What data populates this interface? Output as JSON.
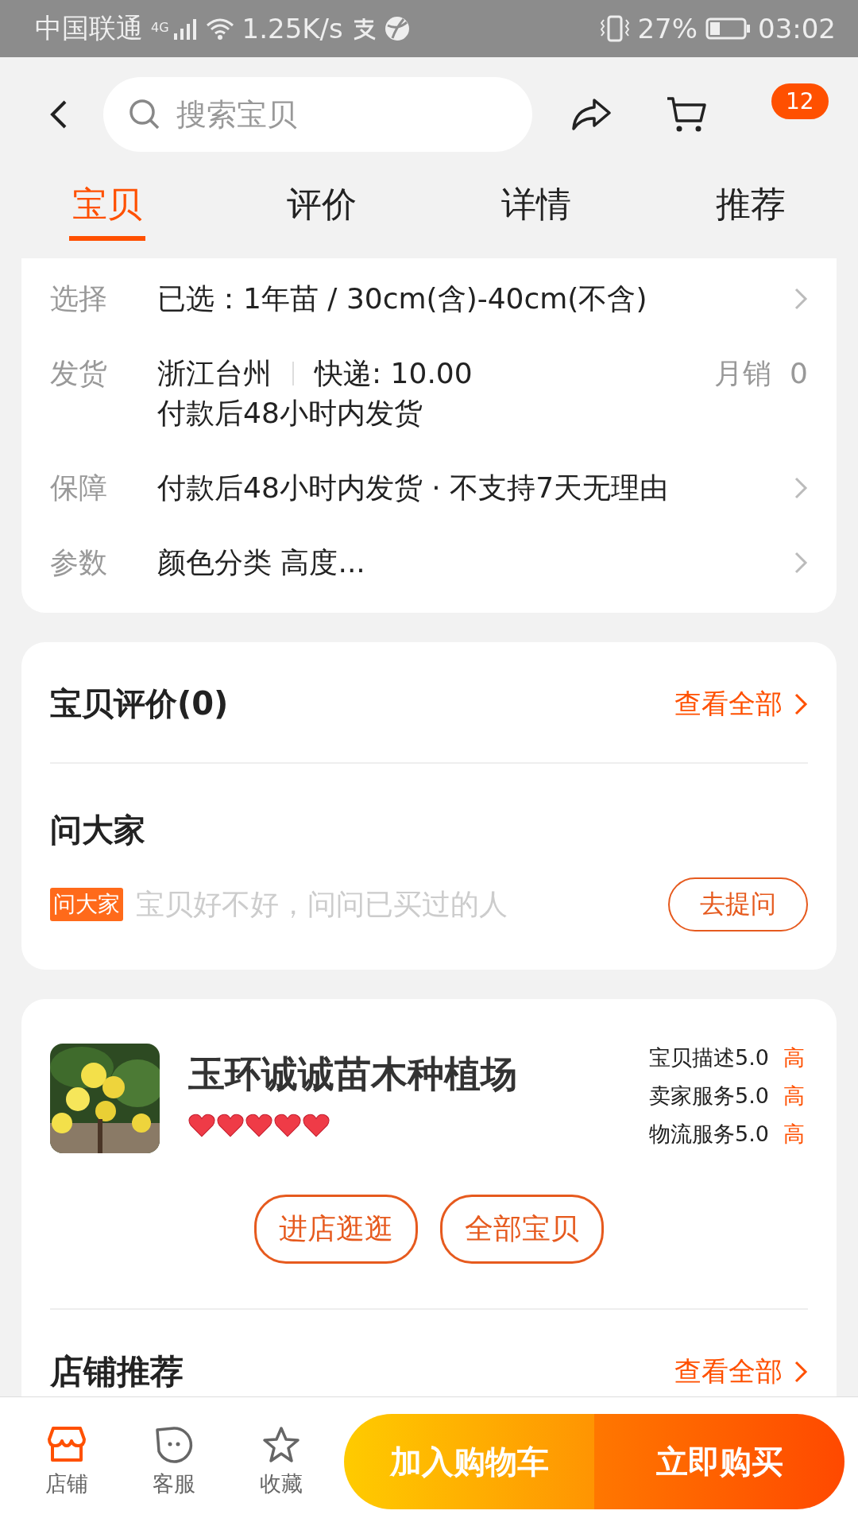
{
  "status_bar": {
    "carrier": "中国联通",
    "network": "4G",
    "speed": "1.25K/s",
    "battery": "27%",
    "time": "03:02"
  },
  "header": {
    "search": {
      "placeholder": "搜索宝贝"
    },
    "badge": "12"
  },
  "tabs": [
    {
      "label": "宝贝",
      "selected": true
    },
    {
      "label": "评价",
      "selected": false
    },
    {
      "label": "详情",
      "selected": false
    },
    {
      "label": "推荐",
      "selected": false
    }
  ],
  "specs": [
    {
      "kind": "plain",
      "label": "选择",
      "value": "已选：1年苗 / 30cm(含)-40cm(不含)",
      "arrow": true
    },
    {
      "kind": "shipping",
      "label": "发货",
      "origin": "浙江台州",
      "fee": "快递: 10.00",
      "sales": "月销  0",
      "note": "付款后48小时内发货",
      "arrow": false
    },
    {
      "kind": "plain",
      "label": "保障",
      "value": "付款后48小时内发货 · 不支持7天无理由",
      "arrow": true
    },
    {
      "kind": "plain",
      "label": "参数",
      "value": "颜色分类 高度...",
      "arrow": true
    }
  ],
  "reviews": {
    "title": "宝贝评价(0)",
    "link": "查看全部"
  },
  "ask": {
    "title": "问大家",
    "tag": "问大家",
    "prompt": "宝贝好不好，问问已买过的人",
    "button": "去提问"
  },
  "shop": {
    "name": "玉环诚诚苗木种植场",
    "stars": 5,
    "scores": [
      {
        "label": "宝贝描述5.0",
        "grade": "高"
      },
      {
        "label": "卖家服务5.0",
        "grade": "高"
      },
      {
        "label": "物流服务5.0",
        "grade": "高"
      }
    ],
    "buttons": [
      "进店逛逛",
      "全部宝贝"
    ]
  },
  "recommend": {
    "title": "店铺推荐",
    "link": "查看全部"
  },
  "bottom_bar": {
    "items": [
      {
        "kind": "shop",
        "label": "店铺"
      },
      {
        "kind": "service",
        "label": "客服"
      },
      {
        "kind": "favorite",
        "label": "收藏"
      }
    ],
    "add_to_cart": "加入购物车",
    "buy_now": "立即购买"
  }
}
